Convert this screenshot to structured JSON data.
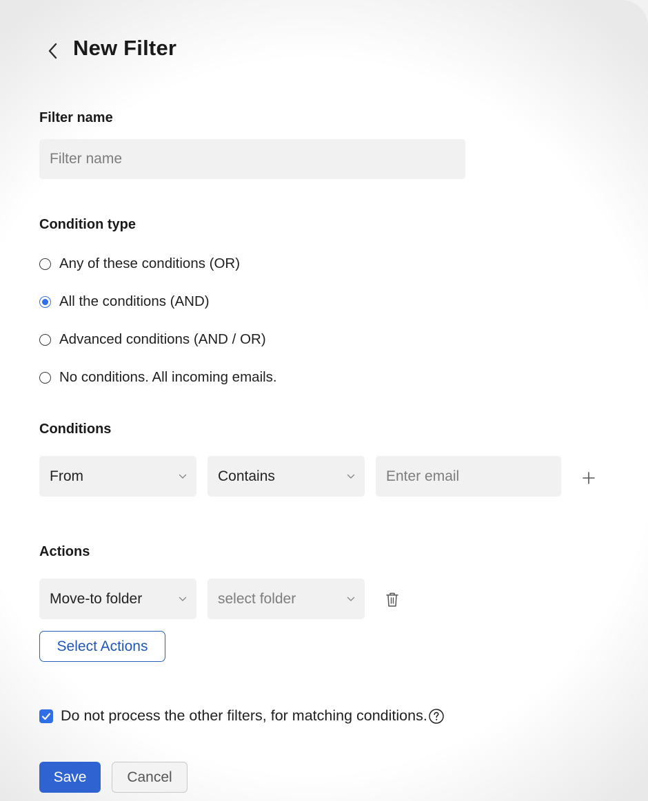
{
  "header": {
    "back_icon": "chevron-left-icon",
    "title": "New Filter"
  },
  "filter_name": {
    "label": "Filter name",
    "placeholder": "Filter name",
    "value": ""
  },
  "condition_type": {
    "label": "Condition type",
    "options": [
      {
        "label": "Any of these conditions (OR)",
        "selected": false
      },
      {
        "label": "All the conditions (AND)",
        "selected": true
      },
      {
        "label": "Advanced conditions (AND / OR)",
        "selected": false
      },
      {
        "label": "No conditions. All incoming emails.",
        "selected": false
      }
    ]
  },
  "conditions": {
    "label": "Conditions",
    "field_select": "From",
    "operator_select": "Contains",
    "value_placeholder": "Enter email",
    "add_icon": "plus-icon"
  },
  "actions": {
    "label": "Actions",
    "action_select": "Move-to folder",
    "folder_select_placeholder": "select folder",
    "delete_icon": "trash-icon",
    "select_actions_button": "Select Actions"
  },
  "options": {
    "stop_processing_label": "Do not process the other filters, for matching conditions.",
    "stop_processing_checked": true,
    "help_icon": "question-circle-icon"
  },
  "footer": {
    "save_label": "Save",
    "cancel_label": "Cancel"
  },
  "colors": {
    "accent": "#2f6fe6",
    "save_button": "#2f63d1",
    "field_bg": "#f1f1f1"
  }
}
